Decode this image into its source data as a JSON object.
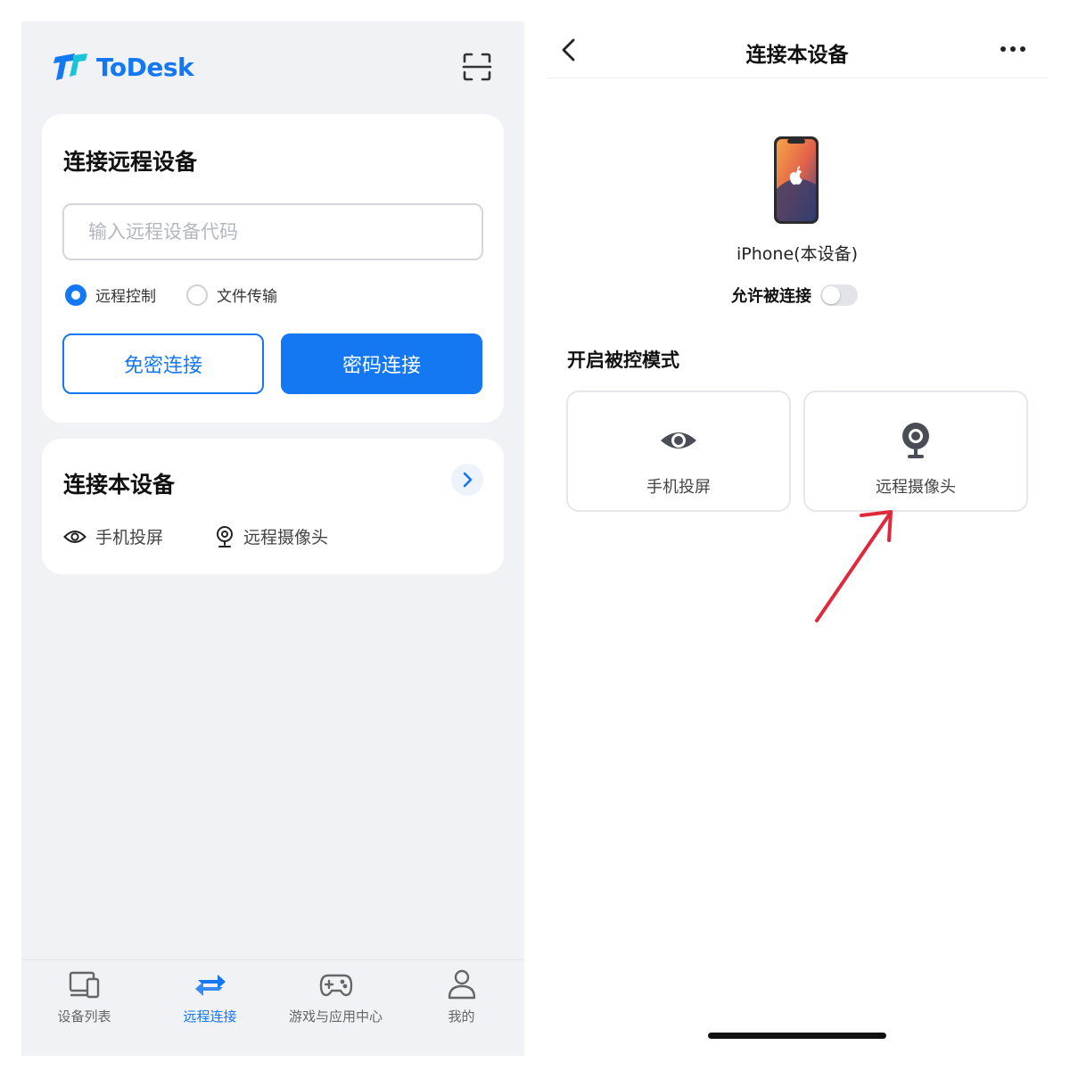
{
  "colors": {
    "accent": "#1478f2",
    "annotation_arrow": "#e02a3c",
    "panel_bg": "#f1f2f6"
  },
  "left": {
    "brand": {
      "name": "ToDesk",
      "logo_icon": "todesk-logo"
    },
    "scan_icon": "scan-icon",
    "connect_remote": {
      "title": "连接远程设备",
      "input": {
        "placeholder": "输入远程设备代码",
        "value": ""
      },
      "options": [
        {
          "label": "远程控制",
          "selected": true
        },
        {
          "label": "文件传输",
          "selected": false
        }
      ],
      "buttons": {
        "no_password": "免密连接",
        "password": "密码连接"
      }
    },
    "connect_local": {
      "title": "连接本设备",
      "items": [
        {
          "label": "手机投屏",
          "icon": "eye-icon"
        },
        {
          "label": "远程摄像头",
          "icon": "webcam-icon"
        }
      ]
    },
    "tabs": [
      {
        "label": "设备列表",
        "icon": "devices-icon",
        "active": false
      },
      {
        "label": "远程连接",
        "icon": "swap-icon",
        "active": true
      },
      {
        "label": "游戏与应用中心",
        "icon": "gamepad-icon",
        "active": false
      },
      {
        "label": "我的",
        "icon": "user-icon",
        "active": false
      }
    ]
  },
  "right": {
    "nav": {
      "title": "连接本设备",
      "back_icon": "back-icon",
      "more_icon": "more-icon"
    },
    "device": {
      "name": "iPhone(本设备)",
      "icon": "iphone-icon"
    },
    "allow": {
      "label": "允许被连接",
      "enabled": false
    },
    "mode_section": {
      "title": "开启被控模式",
      "modes": [
        {
          "label": "手机投屏",
          "icon": "eye-icon"
        },
        {
          "label": "远程摄像头",
          "icon": "webcam-icon"
        }
      ]
    }
  }
}
